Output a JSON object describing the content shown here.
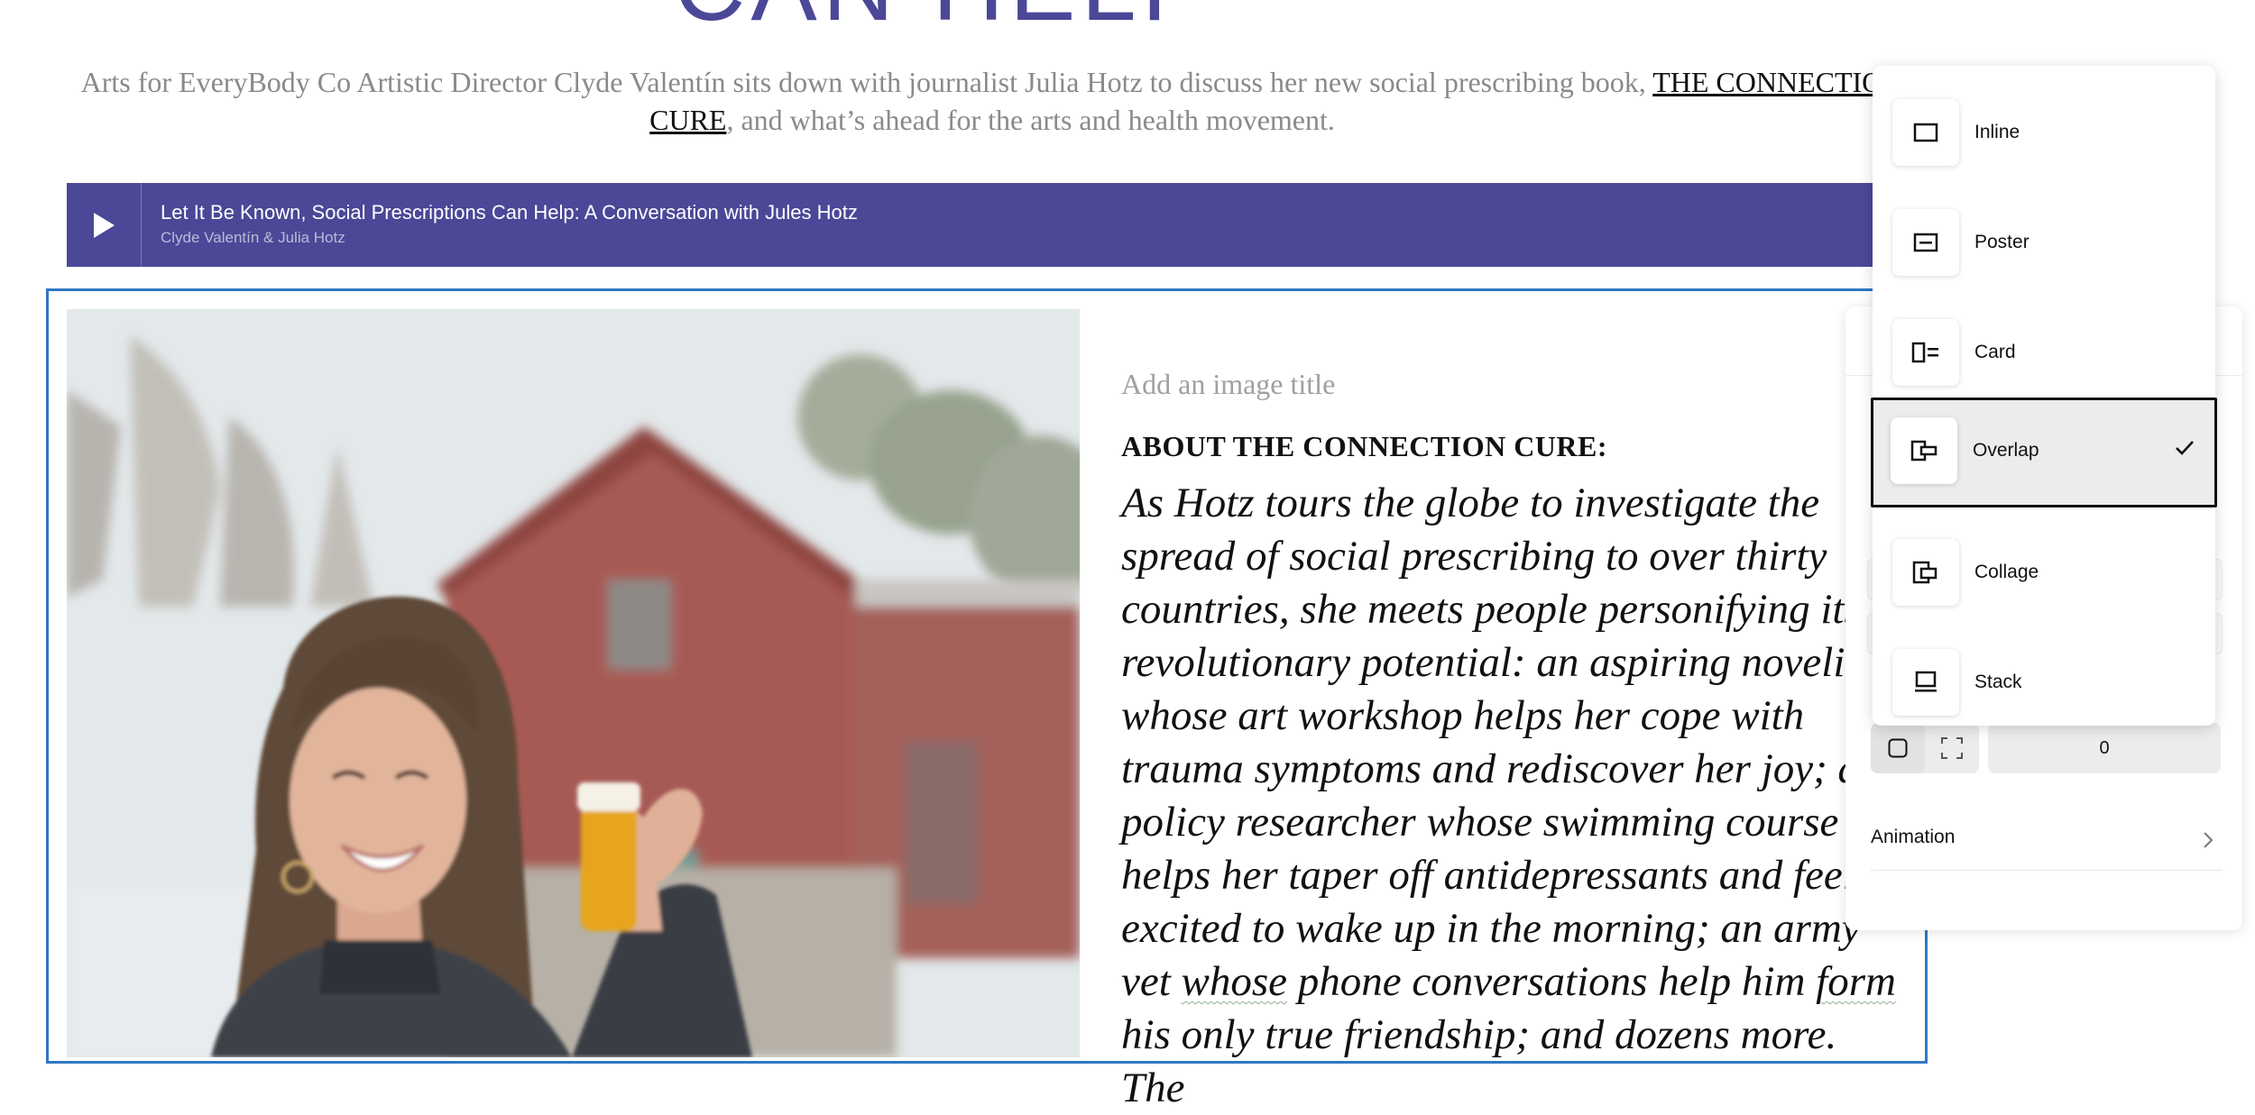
{
  "headline": "CAN HELP",
  "intro": {
    "before": "Arts for EveryBody Co Artistic Director Clyde Valentín sits down with journalist Julia Hotz to discuss her new social prescribing book, ",
    "link": "THE CONNECTION CURE",
    "after": ", and what’s ahead for the arts and health movement."
  },
  "audio": {
    "title": "Let It Be Known, Social Prescriptions Can Help: A Conversation with Jules Hotz",
    "author": "Clyde Valentín & Julia Hotz",
    "play_icon": "play-icon"
  },
  "image_block": {
    "title_placeholder": "Add an image title",
    "subheading": "ABOUT THE CONNECTION CURE:",
    "body_before": "As Hotz tours the globe to investigate the spread of social prescribing to over thirty countries, she meets people personifying its revolutionary potential: an aspiring novelist whose art workshop helps her cope with trauma symptoms and rediscover her joy; a policy researcher whose swimming course helps her taper off antidepressants and feel excited to wake up in the morning; an army vet ",
    "body_w1": "whose",
    "body_mid": " phone conversations help him ",
    "body_w2": "form",
    "body_after": " his only true friendship; and dozens more. The"
  },
  "settings_panel": {
    "padding_value": "0",
    "animation_label": "Animation"
  },
  "layout_menu": {
    "selected": "Overlap",
    "options": [
      {
        "label": "Inline",
        "icon": "inline-layout-icon"
      },
      {
        "label": "Poster",
        "icon": "poster-layout-icon"
      },
      {
        "label": "Card",
        "icon": "card-layout-icon"
      },
      {
        "label": "Overlap",
        "icon": "overlap-layout-icon"
      },
      {
        "label": "Collage",
        "icon": "collage-layout-icon"
      },
      {
        "label": "Stack",
        "icon": "stack-layout-icon"
      }
    ]
  },
  "colors": {
    "accent": "#4b4898",
    "selection_border": "#2f78c4"
  }
}
